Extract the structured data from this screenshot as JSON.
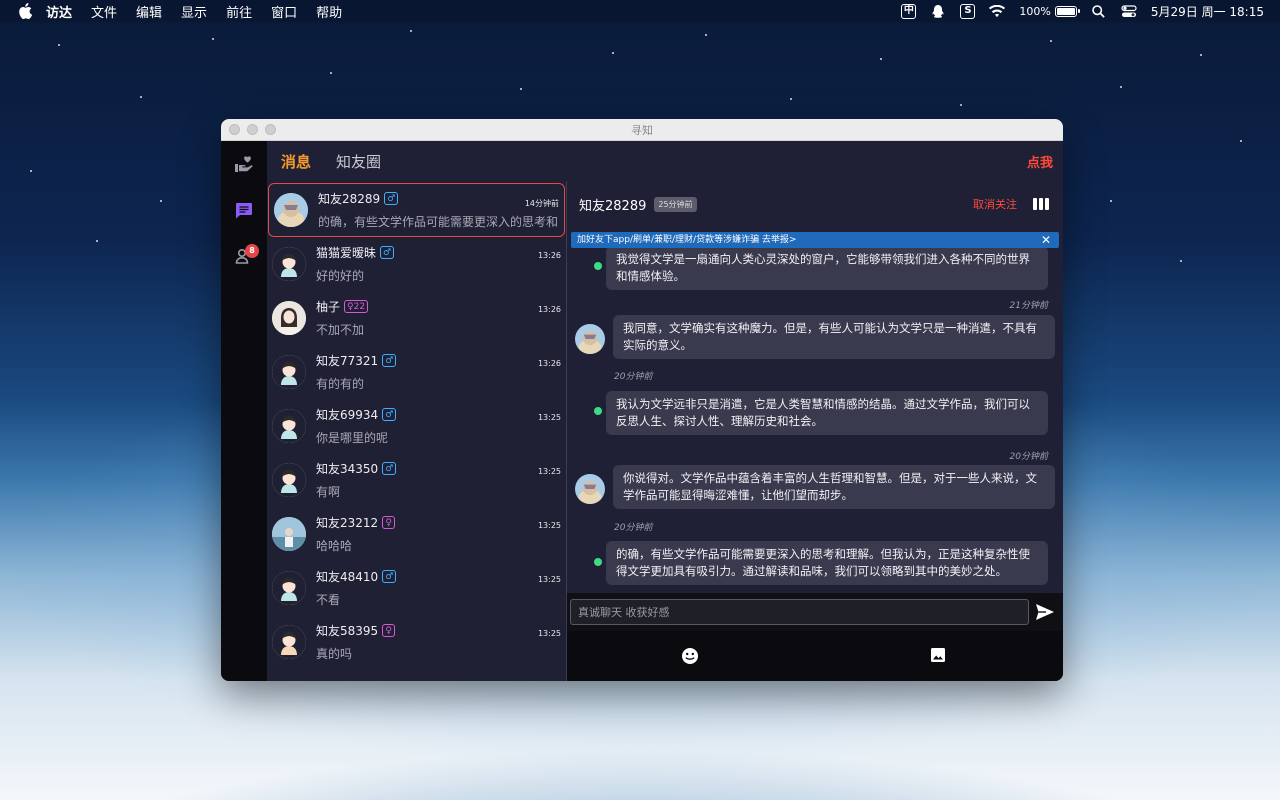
{
  "menubar": {
    "app": "访达",
    "items": [
      "文件",
      "编辑",
      "显示",
      "前往",
      "窗口",
      "帮助"
    ],
    "tray_cn": "中",
    "battery": "100%",
    "battery_level": 1.0,
    "datetime": "5月29日 周一  18:15"
  },
  "window": {
    "title": "寻知"
  },
  "rail": {
    "badge": "8"
  },
  "topnav": {
    "tabs": [
      "消息",
      "知友圈"
    ],
    "me": "点我"
  },
  "conversations": [
    {
      "name": "知友28289",
      "gender": "male",
      "gender_label": "♂",
      "last": "的确，有些文学作品可能需要更深入的思考和",
      "time": "14分钟前",
      "active": true
    },
    {
      "name": "猫猫爱暧昧",
      "gender": "male",
      "gender_label": "♂",
      "last": "好的好的",
      "time": "13:26"
    },
    {
      "name": "柚子",
      "gender": "female",
      "gender_label": "♀22",
      "last": "不加不加",
      "time": "13:26"
    },
    {
      "name": "知友77321",
      "gender": "male",
      "gender_label": "♂",
      "last": "有的有的",
      "time": "13:26"
    },
    {
      "name": "知友69934",
      "gender": "male",
      "gender_label": "♂",
      "last": "你是哪里的呢",
      "time": "13:25"
    },
    {
      "name": "知友34350",
      "gender": "male",
      "gender_label": "♂",
      "last": "有啊",
      "time": "13:25"
    },
    {
      "name": "知友23212",
      "gender": "female",
      "gender_label": "♀",
      "last": "哈哈哈",
      "time": "13:25"
    },
    {
      "name": "知友48410",
      "gender": "male",
      "gender_label": "♂",
      "last": "不看",
      "time": "13:25"
    },
    {
      "name": "知友58395",
      "gender": "female",
      "gender_label": "♀",
      "last": "真的吗",
      "time": "13:25"
    }
  ],
  "chat": {
    "name": "知友28289",
    "ago": "25分钟前",
    "unfollow": "取消关注",
    "notice": "加好友下app/刷单/兼职/理财/贷款等涉嫌诈骗 去举报>",
    "notice_close": "✕",
    "messages": [
      {
        "side": "mine",
        "text": "我觉得文学是一扇通向人类心灵深处的窗户，它能够带领我们进入各种不同的世界和情感体验。"
      },
      {
        "stamp": "21分钟前"
      },
      {
        "side": "theirs",
        "text": "我同意，文学确实有这种魔力。但是，有些人可能认为文学只是一种消遣，不具有实际的意义。"
      },
      {
        "stamp": "20分钟前"
      },
      {
        "side": "mine",
        "text": "我认为文学远非只是消遣，它是人类智慧和情感的结晶。通过文学作品，我们可以反思人生、探讨人性、理解历史和社会。"
      },
      {
        "stamp": "20分钟前"
      },
      {
        "side": "theirs",
        "text": "你说得对。文学作品中蕴含着丰富的人生哲理和智慧。但是，对于一些人来说，文学作品可能显得晦涩难懂，让他们望而却步。"
      },
      {
        "stamp": "20分钟前"
      },
      {
        "side": "mine",
        "text": "的确，有些文学作品可能需要更深入的思考和理解。但我认为，正是这种复杂性使得文学更加具有吸引力。通过解读和品味，我们可以领略到其中的美妙之处。"
      }
    ],
    "input_placeholder": "真诚聊天 收获好感"
  },
  "colors": {
    "accent": "#f39a2b",
    "danger": "#ff4a3a",
    "online": "#3ddc84",
    "notice": "#1f6aba"
  }
}
